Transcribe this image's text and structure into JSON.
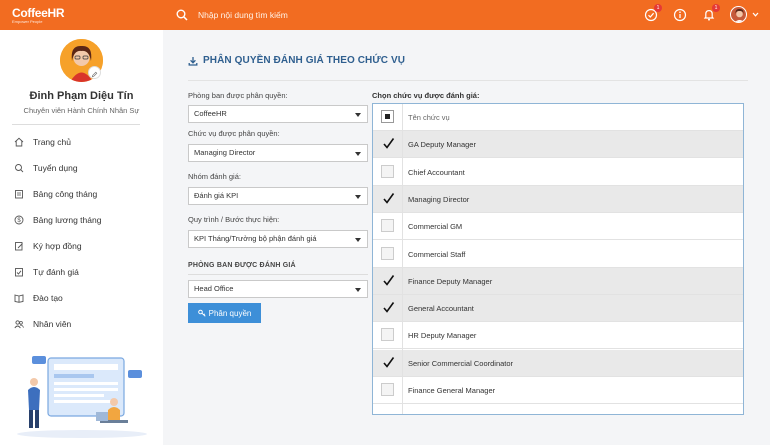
{
  "app": {
    "logo_text": "CoffeeHR",
    "logo_sub": "Empower People",
    "brand_color": "#f26c21"
  },
  "search": {
    "placeholder": "Nhập nội dung tìm kiếm"
  },
  "topbar": {
    "icons": [
      "history-icon",
      "info-icon",
      "bell-icon",
      "user-avatar"
    ],
    "badges": {
      "history": "1",
      "bell": "1"
    }
  },
  "user": {
    "name": "Đinh Phạm Diệu Tín",
    "role": "Chuyên viên Hành Chính Nhân Sự"
  },
  "sidebar": {
    "items": [
      {
        "label": "Trang chủ",
        "icon": "home-icon"
      },
      {
        "label": "Tuyển dụng",
        "icon": "recruit-icon"
      },
      {
        "label": "Bảng công tháng",
        "icon": "timesheet-icon"
      },
      {
        "label": "Bảng lương tháng",
        "icon": "payroll-icon"
      },
      {
        "label": "Ký hợp đồng",
        "icon": "contract-icon"
      },
      {
        "label": "Tự đánh giá",
        "icon": "self-review-icon"
      },
      {
        "label": "Đào tạo",
        "icon": "training-icon"
      },
      {
        "label": "Nhân viên",
        "icon": "employees-icon"
      }
    ]
  },
  "page": {
    "title": "PHÂN QUYỀN ĐÁNH GIÁ THEO CHỨC VỤ"
  },
  "form": {
    "dept_label": "Phòng ban được phân quyền:",
    "dept_value": "CoffeeHR",
    "position_label": "Chức vụ được phân quyền:",
    "position_value": "Managing Director",
    "group_label": "Nhóm đánh giá:",
    "group_value": "Đánh giá KPI",
    "process_label": "Quy trình / Bước thực hiện:",
    "process_value": "KPI Tháng/Trưởng bộ phận đánh giá",
    "eval_dept_label": "PHÒNG BAN ĐƯỢC ĐÁNH GIÁ",
    "eval_dept_value": "Head Office",
    "submit_label": "Phân quyền"
  },
  "positions": {
    "heading": "Chọn chức vụ được đánh giá:",
    "column_header": "Tên chức vụ",
    "rows": [
      {
        "name": "GA Deputy Manager",
        "checked": true
      },
      {
        "name": "Chief Accountant",
        "checked": false
      },
      {
        "name": "Managing Director",
        "checked": true
      },
      {
        "name": "Commercial GM",
        "checked": false
      },
      {
        "name": "Commercial Staff",
        "checked": false
      },
      {
        "name": "Finance Deputy Manager",
        "checked": true
      },
      {
        "name": "General Accountant",
        "checked": true
      },
      {
        "name": "HR Deputy Manager",
        "checked": false
      },
      {
        "name": "Senior Commercial Coordinator",
        "checked": true
      },
      {
        "name": "Finance General Manager",
        "checked": false
      }
    ]
  }
}
